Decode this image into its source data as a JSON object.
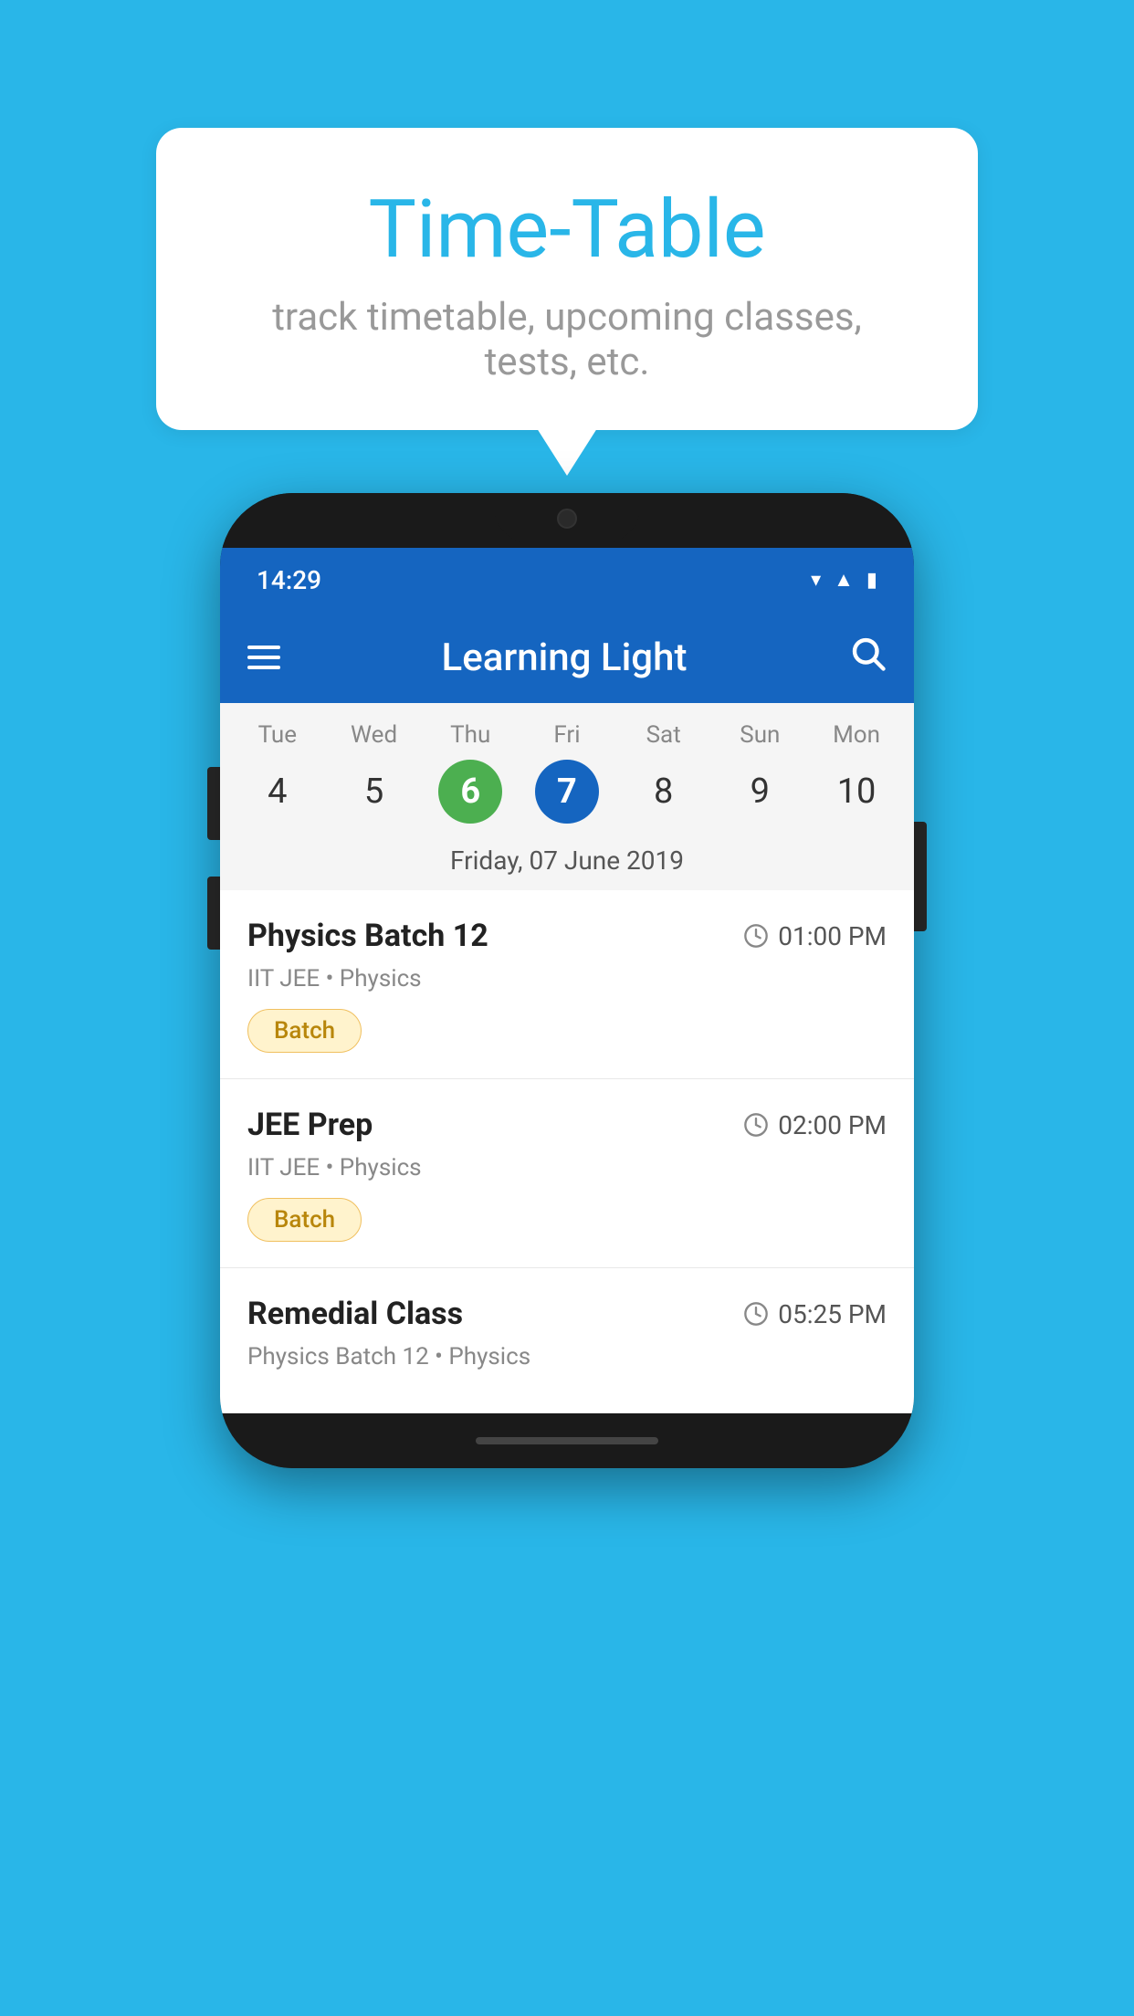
{
  "background_color": "#29b6e8",
  "bubble": {
    "title": "Time-Table",
    "subtitle": "track timetable, upcoming classes, tests, etc."
  },
  "app": {
    "title": "Learning Light",
    "status_time": "14:29"
  },
  "calendar": {
    "days": [
      {
        "name": "Tue",
        "number": "4",
        "state": "normal"
      },
      {
        "name": "Wed",
        "number": "5",
        "state": "normal"
      },
      {
        "name": "Thu",
        "number": "6",
        "state": "today"
      },
      {
        "name": "Fri",
        "number": "7",
        "state": "selected"
      },
      {
        "name": "Sat",
        "number": "8",
        "state": "normal"
      },
      {
        "name": "Sun",
        "number": "9",
        "state": "normal"
      },
      {
        "name": "Mon",
        "number": "10",
        "state": "normal"
      }
    ],
    "selected_date_label": "Friday, 07 June 2019"
  },
  "schedule": [
    {
      "title": "Physics Batch 12",
      "time": "01:00 PM",
      "subtitle": "IIT JEE • Physics",
      "badge": "Batch"
    },
    {
      "title": "JEE Prep",
      "time": "02:00 PM",
      "subtitle": "IIT JEE • Physics",
      "badge": "Batch"
    },
    {
      "title": "Remedial Class",
      "time": "05:25 PM",
      "subtitle": "Physics Batch 12 • Physics",
      "badge": null
    }
  ]
}
